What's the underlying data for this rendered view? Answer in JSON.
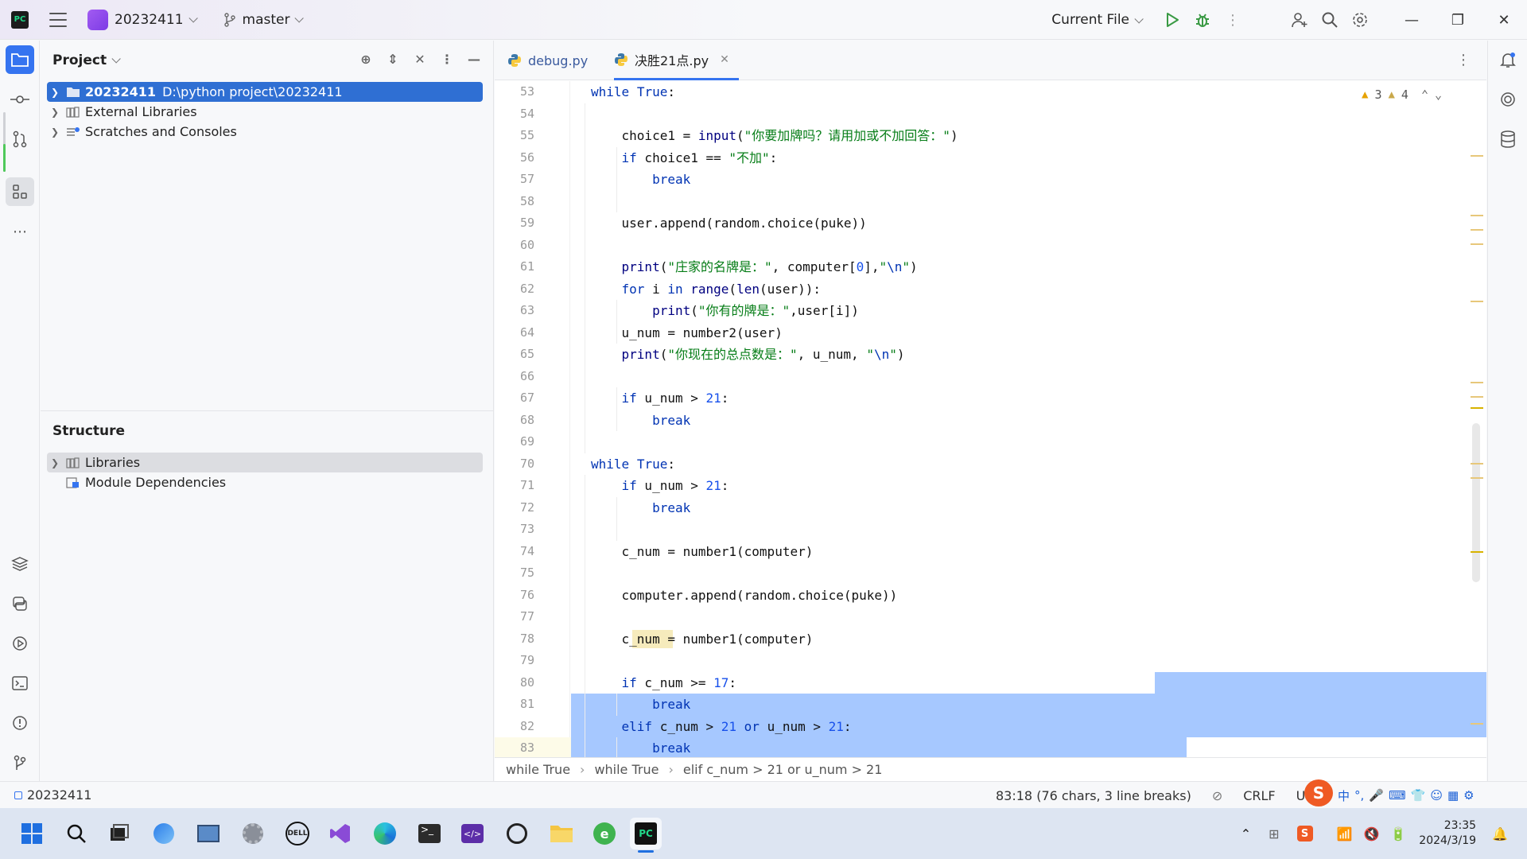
{
  "titlebar": {
    "project": "20232411",
    "branch": "master",
    "run_config": "Current File"
  },
  "project_panel": {
    "title": "Project",
    "tree": [
      {
        "name": "20232411",
        "path": "D:\\python project\\20232411"
      },
      {
        "name": "External Libraries"
      },
      {
        "name": "Scratches and Consoles"
      }
    ]
  },
  "structure_panel": {
    "title": "Structure",
    "tree": [
      {
        "name": "Libraries"
      },
      {
        "name": "Module Dependencies"
      }
    ]
  },
  "tabs": [
    {
      "label": "debug.py"
    },
    {
      "label": "决胜21点.py"
    }
  ],
  "inspections": {
    "warnings": "3",
    "weak_warnings": "4"
  },
  "code_lines": [
    {
      "n": "53",
      "t": "    while True:"
    },
    {
      "n": "54",
      "t": ""
    },
    {
      "n": "55",
      "t": "        choice1 = input(\"你要加牌吗？请用加或不加回答：\")"
    },
    {
      "n": "56",
      "t": "        if choice1 == \"不加\":"
    },
    {
      "n": "57",
      "t": "            break"
    },
    {
      "n": "58",
      "t": ""
    },
    {
      "n": "59",
      "t": "        user.append(random.choice(puke))"
    },
    {
      "n": "60",
      "t": ""
    },
    {
      "n": "61",
      "t": "        print(\"庄家的名牌是：\", computer[0],\"\\n\")"
    },
    {
      "n": "62",
      "t": "        for i in range(len(user)):"
    },
    {
      "n": "63",
      "t": "            print(\"你有的牌是：\",user[i])"
    },
    {
      "n": "64",
      "t": "        u_num = number2(user)"
    },
    {
      "n": "65",
      "t": "        print(\"你现在的总点数是：\", u_num, \"\\n\")"
    },
    {
      "n": "66",
      "t": ""
    },
    {
      "n": "67",
      "t": "        if u_num > 21:"
    },
    {
      "n": "68",
      "t": "            break"
    },
    {
      "n": "69",
      "t": ""
    },
    {
      "n": "70",
      "t": "    while True:"
    },
    {
      "n": "71",
      "t": "        if u_num > 21:"
    },
    {
      "n": "72",
      "t": "            break"
    },
    {
      "n": "73",
      "t": ""
    },
    {
      "n": "74",
      "t": "        c_num = number1(computer)"
    },
    {
      "n": "75",
      "t": ""
    },
    {
      "n": "76",
      "t": "        computer.append(random.choice(puke))"
    },
    {
      "n": "77",
      "t": ""
    },
    {
      "n": "78",
      "t": "        c_num = number1(computer)"
    },
    {
      "n": "79",
      "t": ""
    },
    {
      "n": "80",
      "t": "        if c_num >= 17:"
    },
    {
      "n": "81",
      "t": "            break"
    },
    {
      "n": "82",
      "t": "        elif c_num > 21 or u_num > 21:"
    },
    {
      "n": "83",
      "t": "            break"
    }
  ],
  "breadcrumb": [
    "while True",
    "while True",
    "elif c_num > 21 or u_num > 21"
  ],
  "statusbar": {
    "project": "20232411",
    "position": "83:18 (76 chars, 3 line breaks)",
    "line_sep": "CRLF",
    "encoding": "UTF",
    "ime_mode": "中"
  },
  "taskbar": {
    "time": "23:35",
    "date": "2024/3/19"
  }
}
